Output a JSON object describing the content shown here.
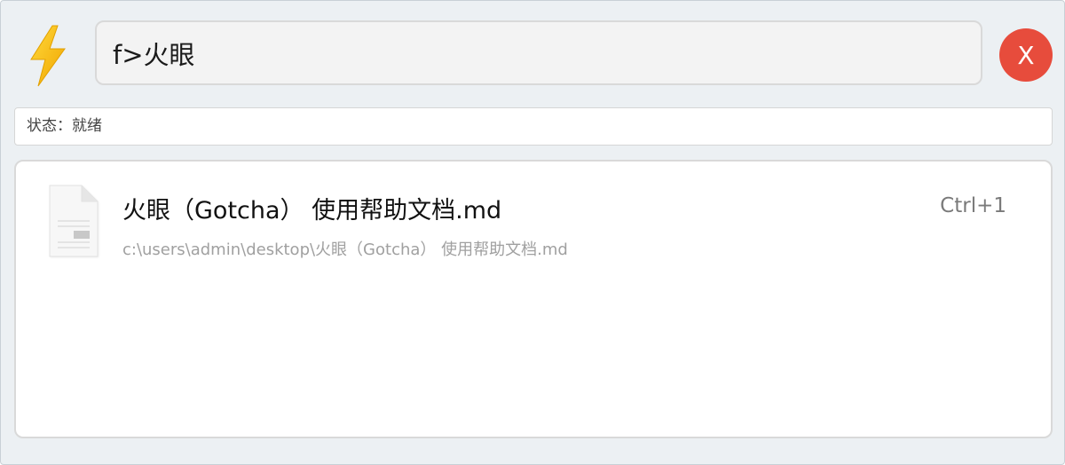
{
  "search": {
    "value": "f>火眼"
  },
  "close_button": {
    "label": "X"
  },
  "status": {
    "text": "状态：就绪"
  },
  "results": [
    {
      "title": "火眼（Gotcha） 使用帮助文档.md",
      "path": "c:\\users\\admin\\desktop\\火眼（Gotcha） 使用帮助文档.md",
      "shortcut": "Ctrl+1",
      "icon": "markdown-file-icon"
    }
  ],
  "colors": {
    "window_bg": "#ecf0f3",
    "close_button": "#e74c3c",
    "logo_bolt": "#f5c518",
    "path_text": "#a0a0a0"
  },
  "icons": {
    "logo": "lightning-bolt-icon",
    "close": "close-icon"
  }
}
